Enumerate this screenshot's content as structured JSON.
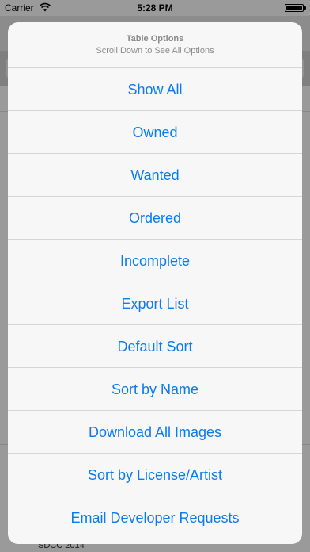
{
  "status_bar": {
    "carrier": "Carrier",
    "time": "5:28 PM",
    "battery_level": 1.0
  },
  "background": {
    "row_text": "SDCC 2014"
  },
  "action_sheet": {
    "title": "Table Options",
    "subtitle": "Scroll Down to See All Options",
    "options": [
      "Show All",
      "Owned",
      "Wanted",
      "Ordered",
      "Incomplete",
      "Export List",
      "Default Sort",
      "Sort by Name",
      "Download All Images",
      "Sort by License/Artist",
      "Email Developer Requests"
    ],
    "option_color": "#0a7bf0"
  }
}
